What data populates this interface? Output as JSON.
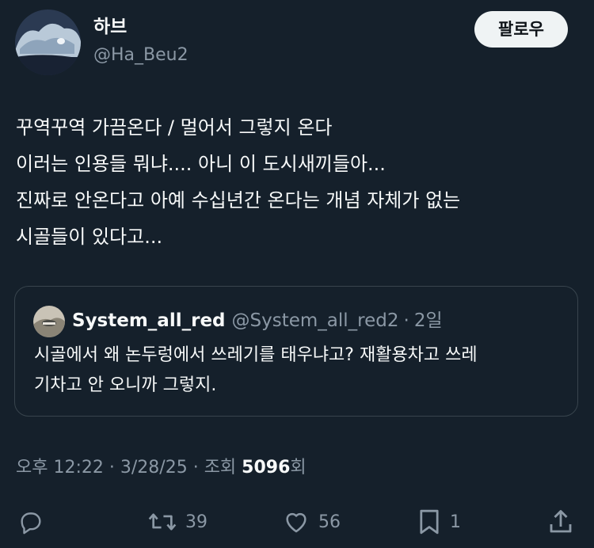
{
  "author": {
    "display_name": "하브",
    "handle": "@Ha_Beu2",
    "avatar_icon": "avatar-image"
  },
  "follow_label": "팔로우",
  "tweet": {
    "lines": [
      "꾸역꾸역 가끔온다 / 멀어서 그렇지 온다",
      "이러는 인용들 뭐냐....  아니 이 도시새끼들아...",
      "진짜로 안온다고 아예 수십년간 온다는 개념 자체가 없는",
      "시골들이 있다고..."
    ]
  },
  "quote": {
    "name": "System_all_red",
    "handle": "@System_all_red2",
    "separator": "·",
    "time": "2일",
    "lines": [
      "시골에서 왜 논두렁에서 쓰레기를 태우냐고? 재활용차고 쓰레",
      "기차고 안 오니까 그렇지."
    ]
  },
  "meta": {
    "time": "오후 12:22",
    "date": "3/28/25",
    "views_label": "조회",
    "views_count": "5096",
    "views_suffix": "회",
    "separator": "·"
  },
  "actions": {
    "reply_icon": "reply-icon",
    "retweet_icon": "retweet-icon",
    "retweet_count": "39",
    "like_icon": "heart-icon",
    "like_count": "56",
    "bookmark_icon": "bookmark-icon",
    "bookmark_count": "1",
    "share_icon": "share-icon"
  },
  "colors": {
    "background": "#15202b",
    "text_primary": "#f7f9f9",
    "text_secondary": "#8b98a5",
    "border": "#38444d",
    "follow_bg": "#eff3f4"
  }
}
